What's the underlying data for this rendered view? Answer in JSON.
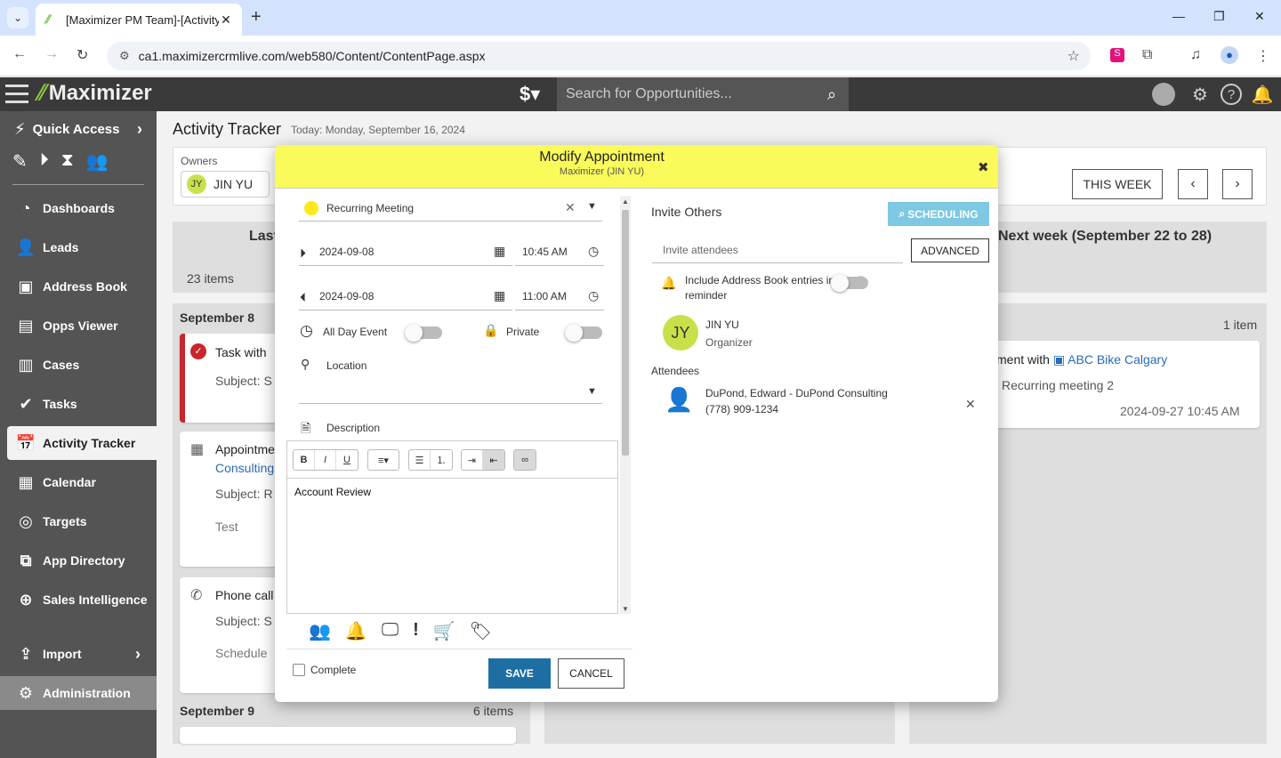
{
  "browser": {
    "tab_title": "[Maximizer PM Team]-[Activity",
    "url": "ca1.maximizercrmlive.com/web580/Content/ContentPage.aspx"
  },
  "app": {
    "logo": "Maximizer",
    "search_placeholder": "Search for Opportunities..."
  },
  "sidebar": {
    "quick_access": "Quick Access",
    "items": [
      {
        "label": "Dashboards",
        "icon": "dashboard-icon"
      },
      {
        "label": "Leads",
        "icon": "leads-icon"
      },
      {
        "label": "Address Book",
        "icon": "address-book-icon"
      },
      {
        "label": "Opps Viewer",
        "icon": "opps-viewer-icon"
      },
      {
        "label": "Cases",
        "icon": "cases-icon"
      },
      {
        "label": "Tasks",
        "icon": "tasks-icon"
      },
      {
        "label": "Activity Tracker",
        "icon": "activity-tracker-icon"
      },
      {
        "label": "Calendar",
        "icon": "calendar-icon"
      },
      {
        "label": "Targets",
        "icon": "targets-icon"
      },
      {
        "label": "App Directory",
        "icon": "app-directory-icon"
      },
      {
        "label": "Sales Intelligence",
        "icon": "sales-intelligence-icon"
      }
    ],
    "import": "Import",
    "administration": "Administration"
  },
  "main": {
    "title": "Activity Tracker",
    "today": "Today: Monday, September 16, 2024",
    "owners_label": "Owners",
    "owner": {
      "initials": "JY",
      "name": "JIN YU"
    },
    "this_week": "THIS WEEK",
    "col_left": {
      "heading": "Last",
      "count": "23 items"
    },
    "col_right": {
      "heading": "Next week (September 22 to 28)",
      "count": "1 item"
    },
    "day1": {
      "label": "September 8"
    },
    "day2": {
      "label": "September 9",
      "count": "6 items"
    },
    "cards": {
      "task": {
        "title": "Task with",
        "subject": "Subject: S"
      },
      "appt": {
        "title": "Appointme",
        "link": "Consulting",
        "subject": "Subject: R",
        "note": "Test"
      },
      "phone": {
        "title": "Phone call",
        "subject": "Subject: S",
        "sched": "Schedule"
      },
      "next": {
        "prefix": "ment with",
        "link": "ABC Bike Calgary",
        "subject": "Recurring meeting 2",
        "datetime": "2024-09-27 10:45 AM"
      }
    }
  },
  "modal": {
    "title": "Modify Appointment",
    "subtitle": "Maximizer (JIN YU)",
    "category": "Recurring Meeting",
    "start_date": "2024-09-08",
    "start_time": "10:45 AM",
    "end_date": "2024-09-08",
    "end_time": "11:00 AM",
    "all_day": "All Day Event",
    "private": "Private",
    "location": "Location",
    "description": "Description",
    "editor_text": "Account Review",
    "complete": "Complete",
    "save": "SAVE",
    "cancel": "CANCEL",
    "invite_title": "Invite Others",
    "scheduling": "SCHEDULING",
    "invite_placeholder": "Invite attendees",
    "advanced": "ADVANCED",
    "include_line1": "Include Address Book entries in email",
    "include_line2": "reminder",
    "organizer_initials": "JY",
    "organizer_name": "JIN YU",
    "organizer_role": "Organizer",
    "attendees_label": "Attendees",
    "attendee_name": "DuPond, Edward - DuPond Consulting",
    "attendee_phone": "(778) 909-1234"
  }
}
